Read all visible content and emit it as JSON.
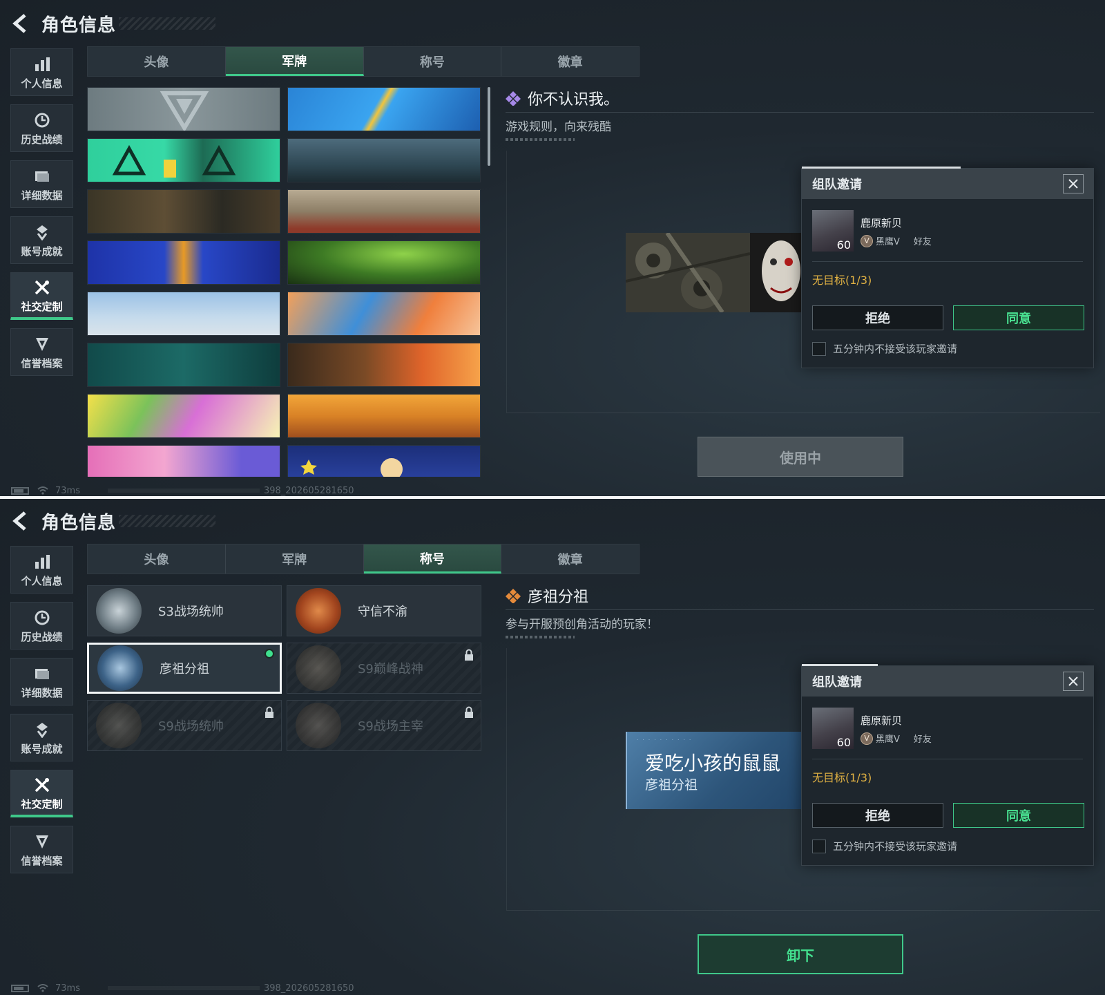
{
  "screens": [
    {
      "header": {
        "title": "角色信息"
      },
      "sidebar": [
        {
          "label": "个人信息",
          "icon": "bar-chart-icon"
        },
        {
          "label": "历史战绩",
          "icon": "clock-icon"
        },
        {
          "label": "详细数据",
          "icon": "folder-icon"
        },
        {
          "label": "账号成就",
          "icon": "achievement-icon"
        },
        {
          "label": "社交定制",
          "icon": "wrench-icon",
          "active": true
        },
        {
          "label": "信誉档案",
          "icon": "shield-icon"
        }
      ],
      "tabs": [
        {
          "label": "头像"
        },
        {
          "label": "军牌",
          "active": true
        },
        {
          "label": "称号"
        },
        {
          "label": "徽章"
        }
      ],
      "detail": {
        "title": "你不认识我。",
        "description": "游戏规则，向来残酷"
      },
      "action_button": "使用中",
      "status": {
        "ping": "73ms",
        "build": "398_202605281650"
      }
    },
    {
      "header": {
        "title": "角色信息"
      },
      "sidebar": [
        {
          "label": "个人信息",
          "icon": "bar-chart-icon"
        },
        {
          "label": "历史战绩",
          "icon": "clock-icon"
        },
        {
          "label": "详细数据",
          "icon": "folder-icon"
        },
        {
          "label": "账号成就",
          "icon": "achievement-icon"
        },
        {
          "label": "社交定制",
          "icon": "wrench-icon",
          "active": true
        },
        {
          "label": "信誉档案",
          "icon": "shield-icon"
        }
      ],
      "tabs": [
        {
          "label": "头像"
        },
        {
          "label": "军牌"
        },
        {
          "label": "称号",
          "active": true
        },
        {
          "label": "徽章"
        }
      ],
      "titles": [
        {
          "name": "S3战场统帅",
          "locked": false,
          "selected": false
        },
        {
          "name": "守信不渝",
          "locked": false,
          "selected": false
        },
        {
          "name": "彦祖分祖",
          "locked": false,
          "selected": true
        },
        {
          "name": "S9巅峰战神",
          "locked": true,
          "selected": false
        },
        {
          "name": "S9战场统帅",
          "locked": true,
          "selected": false
        },
        {
          "name": "S9战场主宰",
          "locked": true,
          "selected": false
        }
      ],
      "detail": {
        "title": "彦祖分祖",
        "description": "参与开服预创角活动的玩家！"
      },
      "preview": {
        "player_name": "爱吃小孩的鼠鼠",
        "title": "彦祖分祖"
      },
      "action_button": "卸下",
      "status": {
        "ping": "73ms",
        "build": "398_202605281650"
      }
    }
  ],
  "invite": {
    "title": "组队邀请",
    "player_name": "鹿原新贝",
    "level": "60",
    "rank": "黑鹰V",
    "relation": "好友",
    "status": "无目标(1/3)",
    "reject_label": "拒绝",
    "accept_label": "同意",
    "mute_label": "五分钟内不接受该玩家邀请"
  },
  "colors": {
    "accent_green": "#3fc88a",
    "status_yellow": "#e0b143",
    "diamond_purple": "#a689e8",
    "diamond_orange": "#e58a3a"
  }
}
